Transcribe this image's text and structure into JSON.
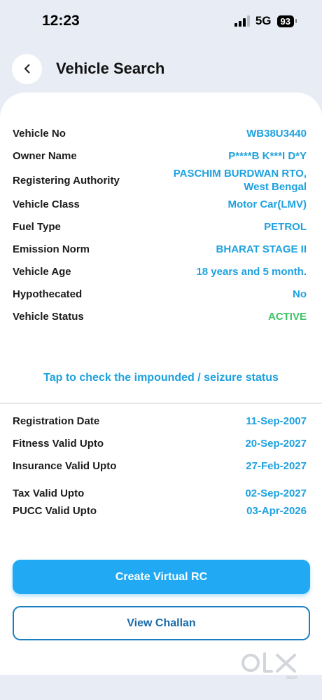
{
  "status_bar": {
    "time": "12:23",
    "network": "5G",
    "battery": "93"
  },
  "header": {
    "title": "Vehicle Search"
  },
  "vehicle_details": [
    {
      "label": "Vehicle No",
      "value": "WB38U3440"
    },
    {
      "label": "Owner Name",
      "value": "P****B K***I D*Y"
    },
    {
      "label": "Registering Authority",
      "value": "PASCHIM BURDWAN RTO,\nWest Bengal"
    },
    {
      "label": "Vehicle Class",
      "value": "Motor Car(LMV)"
    },
    {
      "label": "Fuel Type",
      "value": "PETROL"
    },
    {
      "label": "Emission Norm",
      "value": "BHARAT STAGE II"
    },
    {
      "label": "Vehicle Age",
      "value": "18 years and 5 month."
    },
    {
      "label": "Hypothecated",
      "value": "No"
    },
    {
      "label": "Vehicle Status",
      "value": "ACTIVE"
    }
  ],
  "seizure_link": "Tap to check the impounded / seizure status",
  "validity": [
    {
      "label": "Registration Date",
      "value": "11-Sep-2007"
    },
    {
      "label": "Fitness Valid Upto",
      "value": "20-Sep-2027"
    },
    {
      "label": "Insurance Valid Upto",
      "value": "27-Feb-2027"
    },
    {
      "label": "Tax Valid Upto",
      "value": "02-Sep-2027"
    },
    {
      "label": "PUCC Valid Upto",
      "value": "03-Apr-2026"
    }
  ],
  "buttons": {
    "create_rc": "Create Virtual RC",
    "view_challan": "View Challan"
  },
  "watermark": {
    "brand": "OLX",
    "sub": "INDIA"
  },
  "colors": {
    "accent": "#21aaf3",
    "value_text": "#1ea1df",
    "active": "#3cc267",
    "background": "#e8edf5"
  },
  "icons": {
    "back": "chevron-left-icon",
    "signal": "signal-icon",
    "battery": "battery-icon"
  }
}
